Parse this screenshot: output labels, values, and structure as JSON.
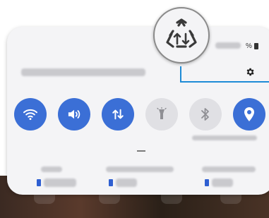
{
  "status": {
    "battery_percent_symbol": "%"
  },
  "header": {
    "settings_icon": "gear-icon"
  },
  "quick_settings": [
    {
      "id": "wifi",
      "icon": "wifi-icon",
      "state": "on"
    },
    {
      "id": "sound",
      "icon": "speaker-icon",
      "state": "on"
    },
    {
      "id": "mobile-data",
      "icon": "data-arrows-icon",
      "state": "on"
    },
    {
      "id": "flashlight",
      "icon": "flashlight-icon",
      "state": "off"
    },
    {
      "id": "bluetooth",
      "icon": "bluetooth-icon",
      "state": "off"
    },
    {
      "id": "location",
      "icon": "location-pin-icon",
      "state": "on"
    }
  ],
  "callout": {
    "icon": "recycle-triangle-icon"
  },
  "colors": {
    "accent": "#3b6fd6",
    "tile_off": "#e0e0e4",
    "callout": "#1e8bd6"
  }
}
